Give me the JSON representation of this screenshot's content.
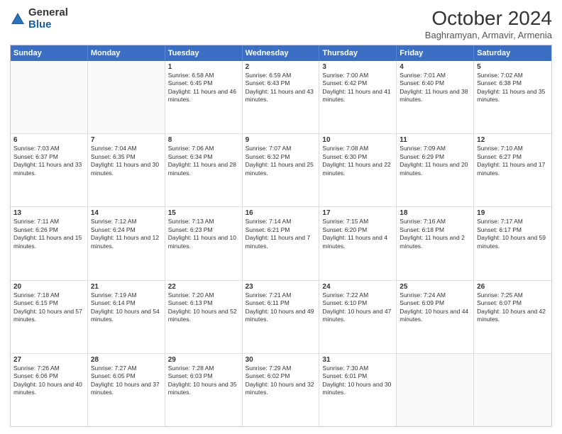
{
  "logo": {
    "line1": "General",
    "line2": "Blue"
  },
  "header": {
    "title": "October 2024",
    "subtitle": "Baghramyan, Armavir, Armenia"
  },
  "weekdays": [
    "Sunday",
    "Monday",
    "Tuesday",
    "Wednesday",
    "Thursday",
    "Friday",
    "Saturday"
  ],
  "rows": [
    [
      {
        "day": "",
        "content": ""
      },
      {
        "day": "",
        "content": ""
      },
      {
        "day": "1",
        "content": "Sunrise: 6:58 AM\nSunset: 6:45 PM\nDaylight: 11 hours and 46 minutes."
      },
      {
        "day": "2",
        "content": "Sunrise: 6:59 AM\nSunset: 6:43 PM\nDaylight: 11 hours and 43 minutes."
      },
      {
        "day": "3",
        "content": "Sunrise: 7:00 AM\nSunset: 6:42 PM\nDaylight: 11 hours and 41 minutes."
      },
      {
        "day": "4",
        "content": "Sunrise: 7:01 AM\nSunset: 6:40 PM\nDaylight: 11 hours and 38 minutes."
      },
      {
        "day": "5",
        "content": "Sunrise: 7:02 AM\nSunset: 6:38 PM\nDaylight: 11 hours and 35 minutes."
      }
    ],
    [
      {
        "day": "6",
        "content": "Sunrise: 7:03 AM\nSunset: 6:37 PM\nDaylight: 11 hours and 33 minutes."
      },
      {
        "day": "7",
        "content": "Sunrise: 7:04 AM\nSunset: 6:35 PM\nDaylight: 11 hours and 30 minutes."
      },
      {
        "day": "8",
        "content": "Sunrise: 7:06 AM\nSunset: 6:34 PM\nDaylight: 11 hours and 28 minutes."
      },
      {
        "day": "9",
        "content": "Sunrise: 7:07 AM\nSunset: 6:32 PM\nDaylight: 11 hours and 25 minutes."
      },
      {
        "day": "10",
        "content": "Sunrise: 7:08 AM\nSunset: 6:30 PM\nDaylight: 11 hours and 22 minutes."
      },
      {
        "day": "11",
        "content": "Sunrise: 7:09 AM\nSunset: 6:29 PM\nDaylight: 11 hours and 20 minutes."
      },
      {
        "day": "12",
        "content": "Sunrise: 7:10 AM\nSunset: 6:27 PM\nDaylight: 11 hours and 17 minutes."
      }
    ],
    [
      {
        "day": "13",
        "content": "Sunrise: 7:11 AM\nSunset: 6:26 PM\nDaylight: 11 hours and 15 minutes."
      },
      {
        "day": "14",
        "content": "Sunrise: 7:12 AM\nSunset: 6:24 PM\nDaylight: 11 hours and 12 minutes."
      },
      {
        "day": "15",
        "content": "Sunrise: 7:13 AM\nSunset: 6:23 PM\nDaylight: 11 hours and 10 minutes."
      },
      {
        "day": "16",
        "content": "Sunrise: 7:14 AM\nSunset: 6:21 PM\nDaylight: 11 hours and 7 minutes."
      },
      {
        "day": "17",
        "content": "Sunrise: 7:15 AM\nSunset: 6:20 PM\nDaylight: 11 hours and 4 minutes."
      },
      {
        "day": "18",
        "content": "Sunrise: 7:16 AM\nSunset: 6:18 PM\nDaylight: 11 hours and 2 minutes."
      },
      {
        "day": "19",
        "content": "Sunrise: 7:17 AM\nSunset: 6:17 PM\nDaylight: 10 hours and 59 minutes."
      }
    ],
    [
      {
        "day": "20",
        "content": "Sunrise: 7:18 AM\nSunset: 6:15 PM\nDaylight: 10 hours and 57 minutes."
      },
      {
        "day": "21",
        "content": "Sunrise: 7:19 AM\nSunset: 6:14 PM\nDaylight: 10 hours and 54 minutes."
      },
      {
        "day": "22",
        "content": "Sunrise: 7:20 AM\nSunset: 6:13 PM\nDaylight: 10 hours and 52 minutes."
      },
      {
        "day": "23",
        "content": "Sunrise: 7:21 AM\nSunset: 6:11 PM\nDaylight: 10 hours and 49 minutes."
      },
      {
        "day": "24",
        "content": "Sunrise: 7:22 AM\nSunset: 6:10 PM\nDaylight: 10 hours and 47 minutes."
      },
      {
        "day": "25",
        "content": "Sunrise: 7:24 AM\nSunset: 6:09 PM\nDaylight: 10 hours and 44 minutes."
      },
      {
        "day": "26",
        "content": "Sunrise: 7:25 AM\nSunset: 6:07 PM\nDaylight: 10 hours and 42 minutes."
      }
    ],
    [
      {
        "day": "27",
        "content": "Sunrise: 7:26 AM\nSunset: 6:06 PM\nDaylight: 10 hours and 40 minutes."
      },
      {
        "day": "28",
        "content": "Sunrise: 7:27 AM\nSunset: 6:05 PM\nDaylight: 10 hours and 37 minutes."
      },
      {
        "day": "29",
        "content": "Sunrise: 7:28 AM\nSunset: 6:03 PM\nDaylight: 10 hours and 35 minutes."
      },
      {
        "day": "30",
        "content": "Sunrise: 7:29 AM\nSunset: 6:02 PM\nDaylight: 10 hours and 32 minutes."
      },
      {
        "day": "31",
        "content": "Sunrise: 7:30 AM\nSunset: 6:01 PM\nDaylight: 10 hours and 30 minutes."
      },
      {
        "day": "",
        "content": ""
      },
      {
        "day": "",
        "content": ""
      }
    ]
  ]
}
